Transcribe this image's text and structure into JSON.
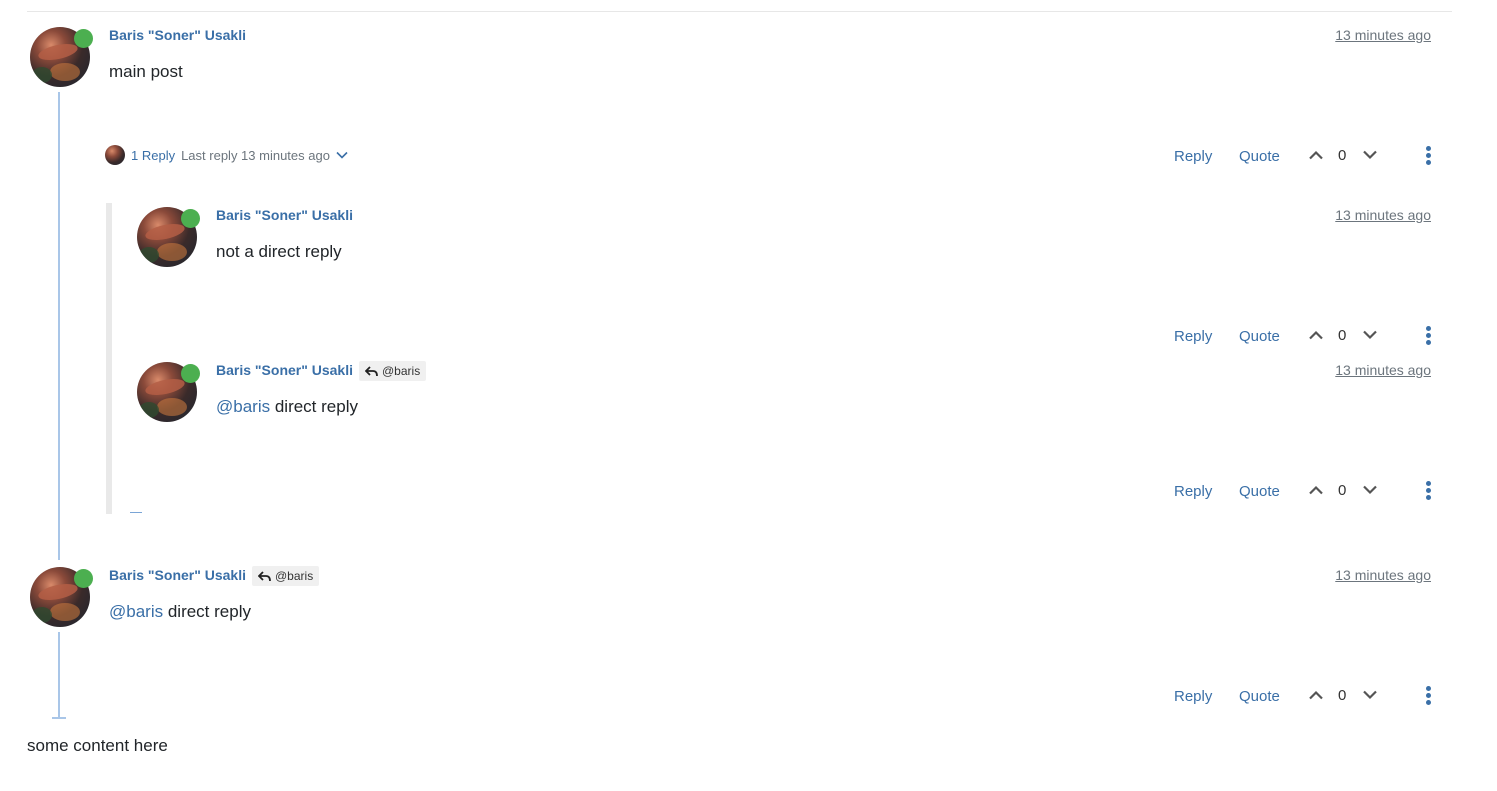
{
  "posts": [
    {
      "author": "Baris \"Soner\" Usakli",
      "timestamp": "13 minutes ago",
      "text": "main post",
      "votes": "0"
    },
    {
      "author": "Baris \"Soner\" Usakli",
      "timestamp": "13 minutes ago",
      "text": "not a direct reply",
      "votes": "0"
    },
    {
      "author": "Baris \"Soner\" Usakli",
      "reply_to": "@baris",
      "timestamp": "13 minutes ago",
      "mention": "@baris",
      "text": " direct reply",
      "votes": "0"
    },
    {
      "author": "Baris \"Soner\" Usakli",
      "reply_to": "@baris",
      "timestamp": "13 minutes ago",
      "mention": "@baris",
      "text": " direct reply",
      "votes": "0"
    }
  ],
  "replies_summary": {
    "count_label": "1 Reply",
    "last_reply_label": "Last reply 13 minutes ago"
  },
  "actions": {
    "reply_label": "Reply",
    "quote_label": "Quote"
  },
  "footer_text": "some content here",
  "colors": {
    "link": "#3a6fa7",
    "online": "#4caf50",
    "thread_line": "#a9c6e8"
  },
  "icons": {
    "upvote": "chevron-up-icon",
    "downvote": "chevron-down-icon",
    "menu": "more-vertical-icon",
    "reply_to": "reply-arrow-icon",
    "expand": "chevron-down-icon"
  }
}
